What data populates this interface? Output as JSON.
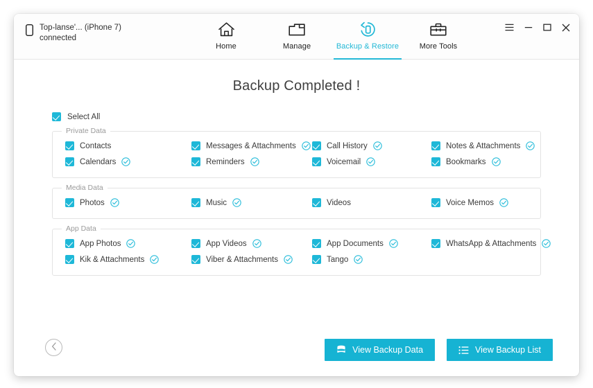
{
  "window": {
    "device_status": "Top-lanse'... (iPhone 7)\nconnected",
    "controls": [
      {
        "name": "menu-button",
        "icon": "hamburger-menu-icon"
      },
      {
        "name": "minimize-button",
        "icon": "minimize-icon"
      },
      {
        "name": "maximize-button",
        "icon": "maximize-icon"
      },
      {
        "name": "close-button",
        "icon": "close-icon"
      }
    ]
  },
  "nav": {
    "tabs": [
      {
        "label": "Home",
        "icon": "home-icon",
        "active": false
      },
      {
        "label": "Manage",
        "icon": "folder-icon",
        "active": false
      },
      {
        "label": "Backup & Restore",
        "icon": "backup-restore-icon",
        "active": true
      },
      {
        "label": "More Tools",
        "icon": "toolbox-icon",
        "active": false
      }
    ]
  },
  "main": {
    "title": "Backup Completed !",
    "select_all_label": "Select All",
    "select_all_checked": true,
    "groups": [
      {
        "legend": "Private Data",
        "rows": [
          [
            {
              "label": "Contacts",
              "checked": true,
              "done": false
            },
            {
              "label": "Messages & Attachments",
              "checked": true,
              "done": true
            },
            {
              "label": "Call History",
              "checked": true,
              "done": true
            },
            {
              "label": "Notes & Attachments",
              "checked": true,
              "done": true
            }
          ],
          [
            {
              "label": "Calendars",
              "checked": true,
              "done": true
            },
            {
              "label": "Reminders",
              "checked": true,
              "done": true
            },
            {
              "label": "Voicemail",
              "checked": true,
              "done": true
            },
            {
              "label": "Bookmarks",
              "checked": true,
              "done": true
            }
          ]
        ]
      },
      {
        "legend": "Media Data",
        "rows": [
          [
            {
              "label": "Photos",
              "checked": true,
              "done": true
            },
            {
              "label": "Music",
              "checked": true,
              "done": true
            },
            {
              "label": "Videos",
              "checked": true,
              "done": false
            },
            {
              "label": "Voice Memos",
              "checked": true,
              "done": true
            }
          ]
        ]
      },
      {
        "legend": "App Data",
        "rows": [
          [
            {
              "label": "App Photos",
              "checked": true,
              "done": true
            },
            {
              "label": "App Videos",
              "checked": true,
              "done": true
            },
            {
              "label": "App Documents",
              "checked": true,
              "done": true
            },
            {
              "label": "WhatsApp & Attachments",
              "checked": true,
              "done": true
            }
          ],
          [
            {
              "label": "Kik & Attachments",
              "checked": true,
              "done": true
            },
            {
              "label": "Viber & Attachments",
              "checked": true,
              "done": true
            },
            {
              "label": "Tango",
              "checked": true,
              "done": true
            },
            {
              "label": "",
              "checked": false,
              "done": false
            }
          ]
        ]
      }
    ]
  },
  "footer": {
    "back_icon": "chevron-left-icon",
    "buttons": [
      {
        "label": "View Backup Data",
        "icon": "database-stack-icon"
      },
      {
        "label": "View Backup List",
        "icon": "list-icon"
      }
    ]
  },
  "colors": {
    "accent": "#1EB8D8",
    "button": "#16B3D3",
    "text": "#3A3A3A",
    "legend": "#9A9A9A",
    "border": "#E3E3E3"
  }
}
